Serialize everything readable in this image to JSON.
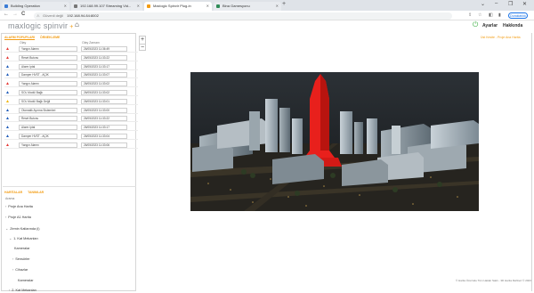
{
  "browser": {
    "tabs": [
      {
        "label": "Building Operation",
        "fav_color": "#3a7bd5"
      },
      {
        "label": "192.168.99.107 Streaming Vid...",
        "fav_color": "#777777"
      },
      {
        "label": "Maxlogic Spinvir Plug-in",
        "fav_color": "#f39c12"
      },
      {
        "label": "Bina Gamesyonu",
        "fav_color": "#2e8b57"
      }
    ],
    "new_tab": "+",
    "window_controls": [
      "⌄",
      "–",
      "❐",
      "✕"
    ],
    "nav": {
      "back": "←",
      "forward": "→",
      "reload": "C",
      "home": "⌂"
    },
    "address": {
      "security": "Güvenli değil",
      "url": "192.168.94.84:8002"
    },
    "profile_label": "Duraklatıldı"
  },
  "app": {
    "logo_text": "maxlogic spinvir",
    "logo_plus": "+",
    "home_icon": "⌂",
    "power_icon": "⏻",
    "menu": {
      "settings": "Ayarlar",
      "about": "Hakkında"
    }
  },
  "left": {
    "tabs": {
      "active": "ALARM POPUPLARI",
      "other": "ÖRNEKLEME"
    },
    "columns": {
      "name": "Olay",
      "date": "Olay Zamanı"
    },
    "alarms": [
      {
        "icon": "▲",
        "color": "#e53935",
        "name": "Yangın Alarmı",
        "time": "26/05/2023 11:36:49"
      },
      {
        "icon": "▲",
        "color": "#e53935",
        "name": "Reset Butonu",
        "time": "26/05/2023 11:33:22"
      },
      {
        "icon": "▲",
        "color": "#1e5bb8",
        "name": "Alarm İptal",
        "time": "26/05/2023 11:33:17"
      },
      {
        "icon": "▲",
        "color": "#1e5bb8",
        "name": "Damper HVST - AÇIK",
        "time": "26/05/2023 11:33:07"
      },
      {
        "icon": "▲",
        "color": "#e53935",
        "name": "Yangın Alarmı",
        "time": "26/05/2023 11:33:02"
      },
      {
        "icon": "▲",
        "color": "#1e5bb8",
        "name": "SOL Modül Bağlı",
        "time": "26/05/2023 11:33:02"
      },
      {
        "icon": "▲",
        "color": "#f0b400",
        "name": "SOL Modül Bağlı Değil",
        "time": "26/05/2023 11:33:01"
      },
      {
        "icon": "▲",
        "color": "#1e5bb8",
        "name": "Otomatik Ayırma Sistemleri",
        "time": "26/05/2023 11:33:00"
      },
      {
        "icon": "▲",
        "color": "#1e5bb8",
        "name": "Reset Butonu",
        "time": "26/05/2023 11:33:22"
      },
      {
        "icon": "▲",
        "color": "#1e5bb8",
        "name": "Alarm İptal",
        "time": "26/05/2023 11:33:17"
      },
      {
        "icon": "▲",
        "color": "#1e5bb8",
        "name": "Damper HVST - AÇIK",
        "time": "26/05/2023 11:33:04"
      },
      {
        "icon": "▲",
        "color": "#e53935",
        "name": "Yangın Alarmı",
        "time": "26/05/2023 11:33:06"
      }
    ],
    "tabs2": {
      "active": "HARİTALAR",
      "other": "TANIMLAR"
    },
    "search_label": "Arama",
    "tree": [
      {
        "chev": "›",
        "label": "Proje Ana Harita"
      },
      {
        "chev": "›",
        "label": "Proje A1 Harita"
      },
      {
        "chev": "⌄",
        "label": "Zemin Katlarında (i)"
      },
      {
        "chev": "⌄",
        "label": "1. Kat Mekanları"
      },
      {
        "chev": "",
        "label": "Kameralar"
      },
      {
        "chev": "›",
        "label": "Sensörler"
      },
      {
        "chev": "›",
        "label": "Cihazlar"
      },
      {
        "chev": "",
        "label": "Kameralar"
      },
      {
        "chev": "›",
        "label": "2. Kat Mekanları"
      },
      {
        "chev": "›",
        "label": "3. Kat Mekanları"
      }
    ]
  },
  "right": {
    "zoom_in": "+",
    "zoom_out": "−",
    "top_link": "Üst Kesite - Proje Ana Harita",
    "footer": "© Harita Üzerinde Tüm Haklar Saklı - 3D Harita Rehberi © 2023"
  },
  "colors": {
    "accent": "#f39c12",
    "highlight_building": "#e8201c",
    "scene_bg": "#1c1f22"
  }
}
